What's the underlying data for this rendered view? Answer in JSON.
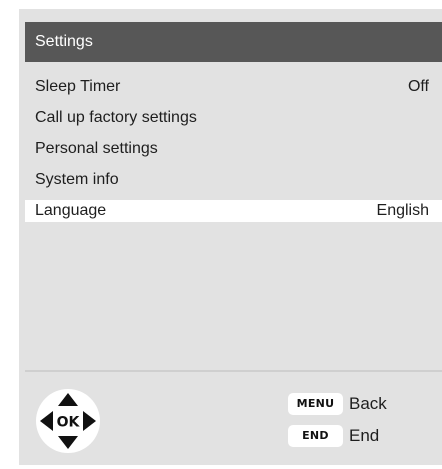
{
  "header": {
    "title": "Settings"
  },
  "menu": {
    "items": [
      {
        "label": "Sleep Timer",
        "value": "Off"
      },
      {
        "label": "Call up factory settings",
        "value": ""
      },
      {
        "label": "Personal settings",
        "value": ""
      },
      {
        "label": "System info",
        "value": ""
      },
      {
        "label": "Language",
        "value": "English",
        "selected": true
      }
    ]
  },
  "footer": {
    "nav_center_label": "OK",
    "keys": [
      {
        "key": "MENU",
        "label": "Back"
      },
      {
        "key": "END",
        "label": "End"
      }
    ]
  },
  "colors": {
    "title_bar": "#575757",
    "panel": "#e2e2e2",
    "selected_row": "#ffffff",
    "text": "#1e1e1e"
  },
  "icons": [
    "navigation-pad-icon",
    "arrow-up-icon",
    "arrow-down-icon",
    "arrow-left-icon",
    "arrow-right-icon"
  ]
}
